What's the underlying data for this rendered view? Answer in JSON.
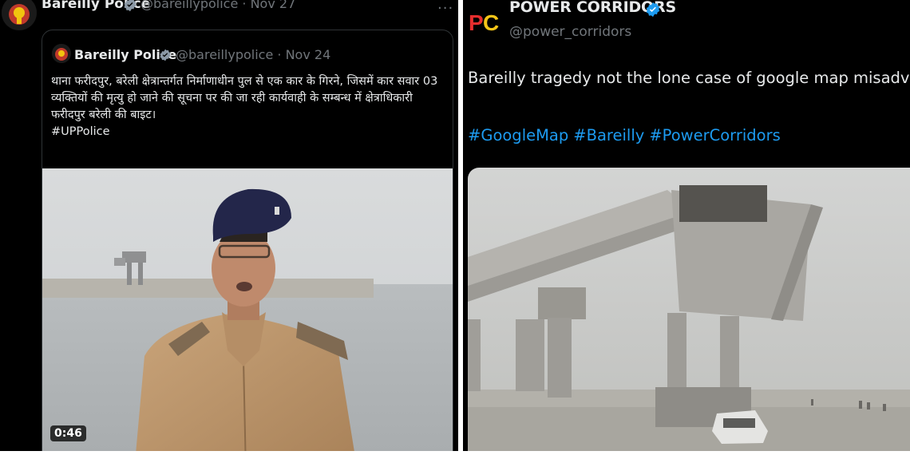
{
  "left_tweet": {
    "author_name": "Bareilly Police",
    "handle": "@bareillypolice",
    "date": "· Nov 27",
    "more_label": "···",
    "quoted": {
      "author_name": "Bareilly Police",
      "handle": "@bareillypolice",
      "date": "· Nov 24",
      "text": "थाना फरीदपुर, बरेली क्षेत्रान्तर्गत निर्माणाधीन पुल से एक कार के गिरने, जिसमें कार सवार 03 व्यक्तियों की मृत्यु हो जाने की सूचना पर की जा रही कार्यवाही के सम्बन्ध में क्षेत्राधिकारी फरीदपुर बरेली की बाइट।",
      "hashtag": "#UPPolice",
      "video_duration": "0:46"
    }
  },
  "right_tweet": {
    "logo_text": "PC",
    "author_name": "POWER CORRIDORS",
    "handle": "@power_corridors",
    "text": "Bareilly tragedy not the lone case of google map misadventure",
    "hashtags": [
      "#GoogleMap",
      "#Bareilly",
      "#PowerCorridors"
    ]
  },
  "colors": {
    "background": "#000000",
    "primary_text": "#e7e9ea",
    "secondary_text": "#71767b",
    "link": "#1d9bf0",
    "verified": "#1d9bf0"
  }
}
